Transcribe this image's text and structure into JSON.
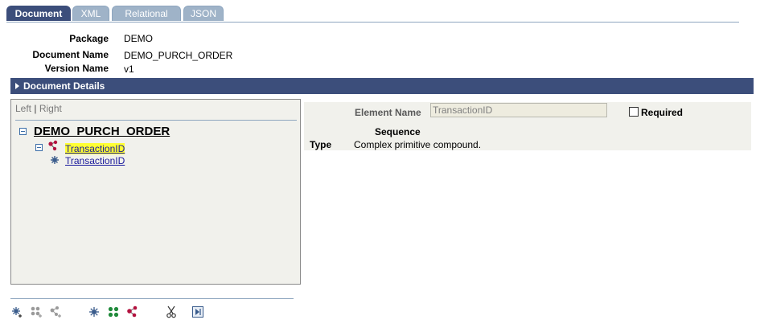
{
  "tabs": [
    {
      "label": "Document",
      "active": true
    },
    {
      "label": "XML",
      "active": false
    },
    {
      "label": "Relational",
      "active": false
    },
    {
      "label": "JSON",
      "active": false
    }
  ],
  "header": {
    "package_label": "Package",
    "package_value": "DEMO",
    "document_name_label": "Document Name",
    "document_name_value": "DEMO_PURCH_ORDER",
    "version_name_label": "Version Name",
    "version_name_value": "v1"
  },
  "section": {
    "title": "Document Details"
  },
  "tree": {
    "left_label": "Left",
    "separator": "|",
    "right_label": "Right",
    "root": "DEMO_PURCH_ORDER",
    "children": [
      {
        "label": "TransactionID",
        "icon": "compound-element-icon",
        "highlighted": true
      },
      {
        "label": "TransactionID",
        "icon": "primitive-element-icon",
        "highlighted": false
      }
    ]
  },
  "detail": {
    "element_name_label": "Element Name",
    "element_name_value": "TransactionID",
    "required_label": "Required",
    "required_checked": false,
    "sequence_label": "Sequence",
    "type_label": "Type",
    "type_value": "Complex primitive compound."
  },
  "toolbar": {
    "icons": [
      "add-primitive-icon",
      "add-collection-icon",
      "add-compound-icon",
      "insert-primitive-icon",
      "insert-collection-icon",
      "insert-compound-icon",
      "cut-icon",
      "expand-icon"
    ]
  },
  "colors": {
    "accent": "#3c4e7b",
    "tab_inactive": "#9fb3c8",
    "panel_bg": "#f1f1ec",
    "highlight": "#ffff33",
    "link": "#1a1a9c"
  }
}
